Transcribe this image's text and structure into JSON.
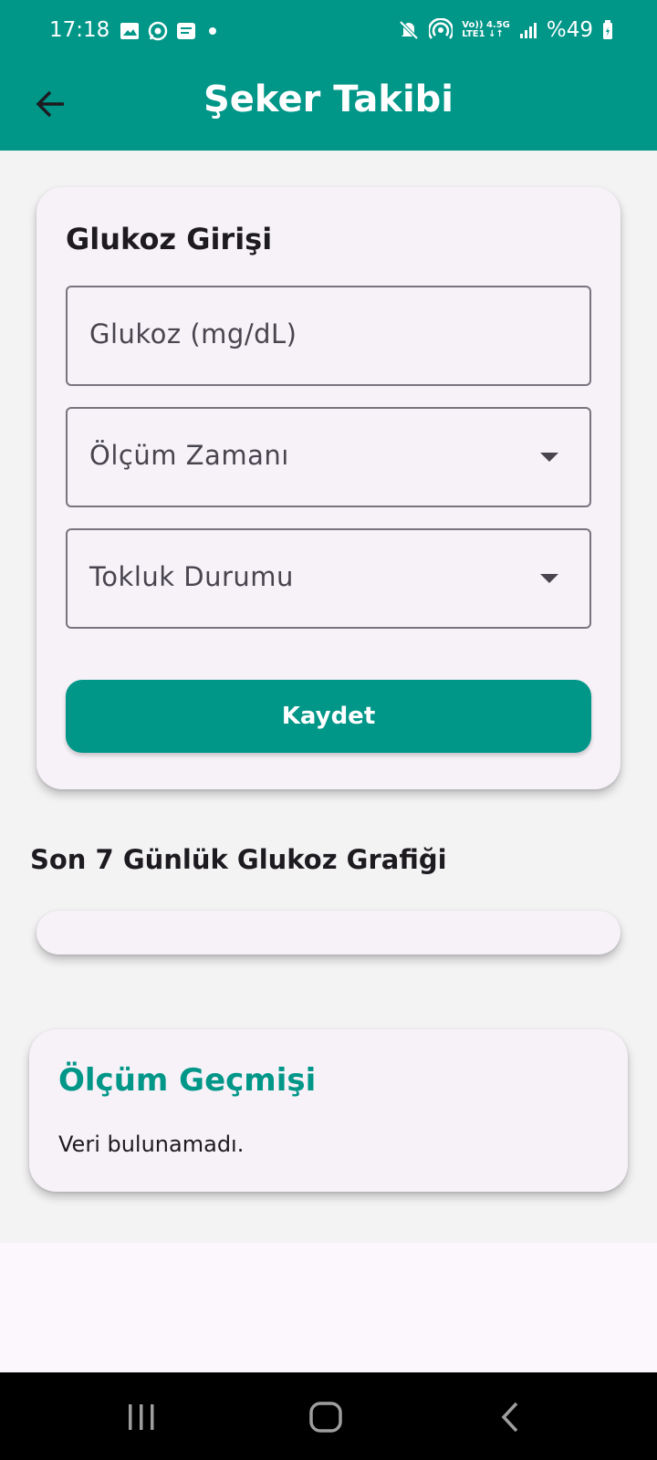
{
  "status_bar": {
    "time": "17:18",
    "battery": "%49",
    "network_top": "Vo)) 4.5G",
    "network_bottom": "LTE1 ↓↑",
    "icons": [
      "image-icon",
      "whatsapp-icon",
      "message-icon",
      "dot-icon",
      "mute-icon",
      "hotspot-icon",
      "signal-icon",
      "battery-icon"
    ]
  },
  "app_bar": {
    "title": "Şeker Takibi",
    "back_icon": "arrow-back-icon"
  },
  "entry_card": {
    "title": "Glukoz Girişi",
    "glucose_field": {
      "label": "Glukoz (mg/dL)"
    },
    "measurement_time_field": {
      "label": "Ölçüm Zamanı"
    },
    "fullness_field": {
      "label": "Tokluk Durumu"
    },
    "save_button": "Kaydet"
  },
  "chart_section": {
    "title": "Son 7 Günlük Glukoz Grafiği"
  },
  "history": {
    "title": "Ölçüm Geçmişi",
    "empty_text": "Veri bulunamadı."
  },
  "colors": {
    "primary": "#009688",
    "card_bg": "#f6f2f8",
    "page_bg": "#f4f3f4"
  },
  "nav_bar": {
    "icons": [
      "recent-apps-icon",
      "home-icon",
      "back-icon"
    ]
  }
}
